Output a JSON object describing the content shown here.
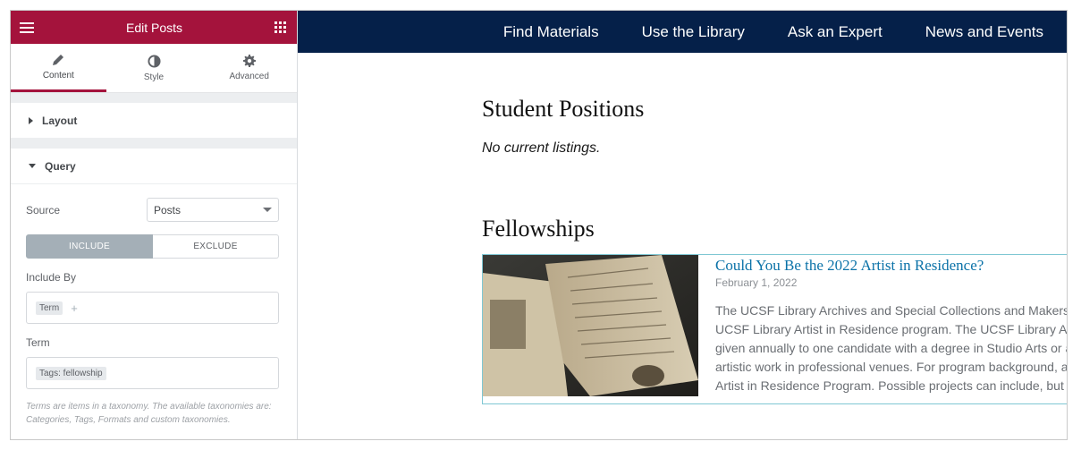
{
  "sidebar": {
    "header_title": "Edit Posts",
    "tabs": [
      {
        "label": "Content",
        "icon": "pencil-icon"
      },
      {
        "label": "Style",
        "icon": "half-circle-icon"
      },
      {
        "label": "Advanced",
        "icon": "gear-icon"
      }
    ],
    "sections": {
      "layout": "Layout",
      "query": "Query"
    },
    "query": {
      "source_label": "Source",
      "source_value": "Posts",
      "include_label": "INCLUDE",
      "exclude_label": "EXCLUDE",
      "include_by_label": "Include By",
      "include_by_chip": "Term",
      "term_label": "Term",
      "term_chip": "Tags: fellowship",
      "help_text": "Terms are items in a taxonomy. The available taxonomies are: Categories, Tags, Formats and custom taxonomies."
    },
    "colors": {
      "accent": "#a4133c",
      "panel": "#eceef0"
    }
  },
  "preview": {
    "nav": [
      "Find Materials",
      "Use the Library",
      "Ask an Expert",
      "News and Events"
    ],
    "student_heading": "Student Positions",
    "no_listings": "No current listings.",
    "fellowships_heading": "Fellowships",
    "post": {
      "title": "Could You Be the 2022 Artist in Residence?",
      "date": "February 1, 2022",
      "excerpt": "The UCSF Library Archives and Special Collections and Makers L\nUCSF Library Artist in Residence program. The UCSF Library Arti\ngiven annually to one candidate with a degree in Studio Arts or a\nartistic work in professional venues. For program background, a\nArtist in Residence Program. Possible projects can include, but a"
    },
    "colors": {
      "nav_bg": "#052049",
      "link": "#0b72a8"
    }
  }
}
